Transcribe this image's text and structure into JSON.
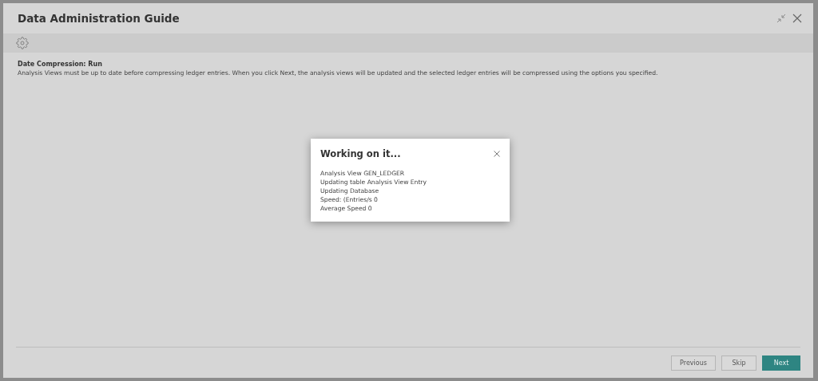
{
  "window": {
    "title": "Data Administration Guide"
  },
  "header": {
    "title": "Date Compression: Run",
    "description": "Analysis Views must be up to date before compressing ledger entries. When you click Next, the analysis views will be updated and the selected ledger entries will be compressed using the options you specified."
  },
  "progress_dialog": {
    "title": "Working on it...",
    "lines": [
      "Analysis View GEN_LEDGER",
      "Updating table Analysis View Entry",
      "Updating Database",
      "Speed: (Entries/s 0",
      "Average Speed 0"
    ]
  },
  "buttons": [
    {
      "label": "Previous",
      "kind": "secondary"
    },
    {
      "label": "Skip",
      "kind": "secondary"
    },
    {
      "label": "Next",
      "kind": "primary"
    }
  ]
}
